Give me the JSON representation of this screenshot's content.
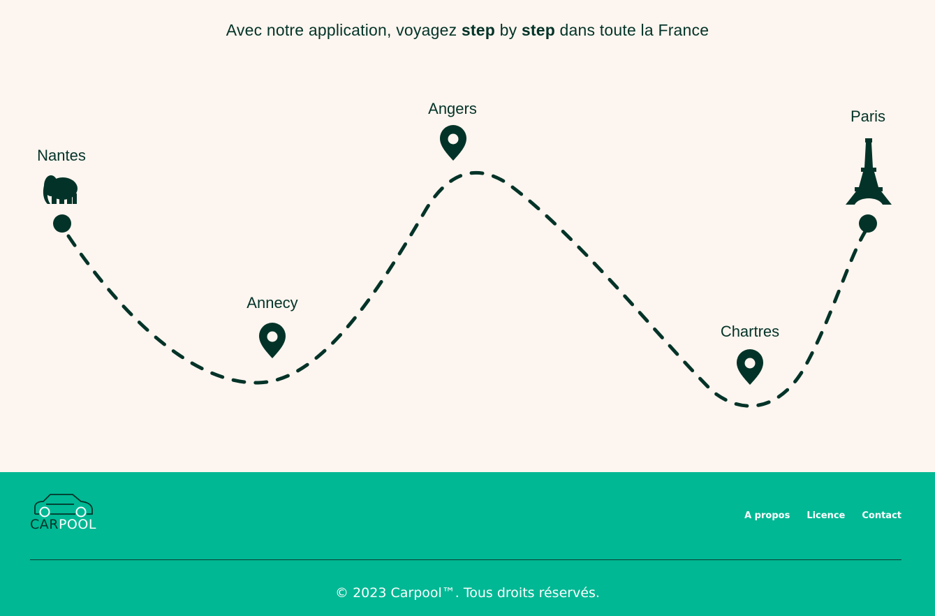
{
  "hero": {
    "title_part1": "Avec notre application, voyagez ",
    "title_bold1": "step",
    "title_part2": " by ",
    "title_bold2": "step",
    "title_part3": " dans toute la France"
  },
  "route": {
    "stops": [
      {
        "name": "Nantes",
        "icon": "elephant-icon"
      },
      {
        "name": "Annecy",
        "icon": "map-pin-icon"
      },
      {
        "name": "Angers",
        "icon": "map-pin-icon"
      },
      {
        "name": "Chartres",
        "icon": "map-pin-icon"
      },
      {
        "name": "Paris",
        "icon": "eiffel-tower-icon"
      }
    ]
  },
  "footer": {
    "logo_car": "CAR",
    "logo_pool": "POOL",
    "nav": [
      {
        "label": "A propos"
      },
      {
        "label": "Licence"
      },
      {
        "label": "Contact"
      }
    ],
    "copyright": "© 2023 Carpool™. Tous droits réservés."
  },
  "colors": {
    "background": "#fdf5ef",
    "dark_green": "#033328",
    "footer_green": "#00b894",
    "white": "#ffffff"
  }
}
